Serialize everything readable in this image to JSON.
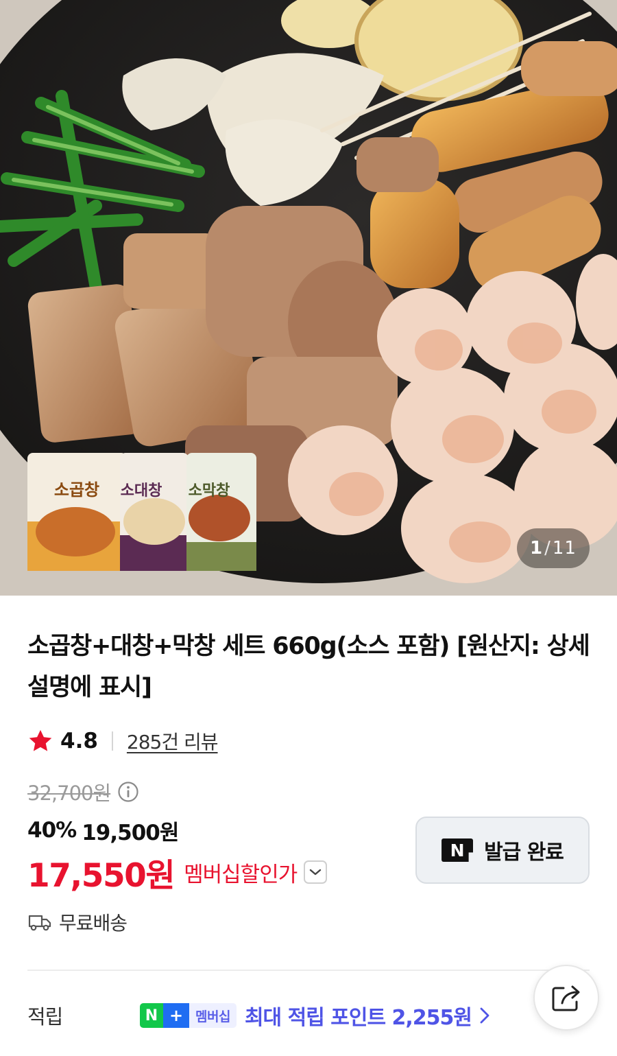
{
  "gallery": {
    "current": "1",
    "separator": "/",
    "total": "11",
    "packages": [
      {
        "name": "소곱창",
        "color": "#e8a43c"
      },
      {
        "name": "소대창",
        "color": "#5b2b53"
      },
      {
        "name": "소막창",
        "color": "#7a8a4a"
      }
    ]
  },
  "product": {
    "title": "소곱창+대창+막창 세트 660g(소스 포함) [원산지: 상세설명에 표시]",
    "rating": "4.8",
    "review_link": "285건 리뷰",
    "original_price": "32,700원",
    "discount_percent": "40%",
    "sale_price": "19,500원",
    "member_price": "17,550원",
    "member_label": "멤버십할인가"
  },
  "coupon": {
    "logo": "N",
    "label": "발급 완료"
  },
  "delivery": {
    "label": "무료배송"
  },
  "points": {
    "label": "적립",
    "badge_n": "N",
    "badge_plus": "+",
    "badge_text": "멤버십",
    "text": "최대 적립 포인트 2,255원"
  },
  "colors": {
    "accent_red": "#e8132f",
    "points_blue": "#4f54e6",
    "naver_green": "#12c74a"
  },
  "icons": [
    "star-icon",
    "info-icon",
    "chevron-down-icon",
    "truck-icon",
    "chevron-right-icon",
    "share-icon"
  ]
}
